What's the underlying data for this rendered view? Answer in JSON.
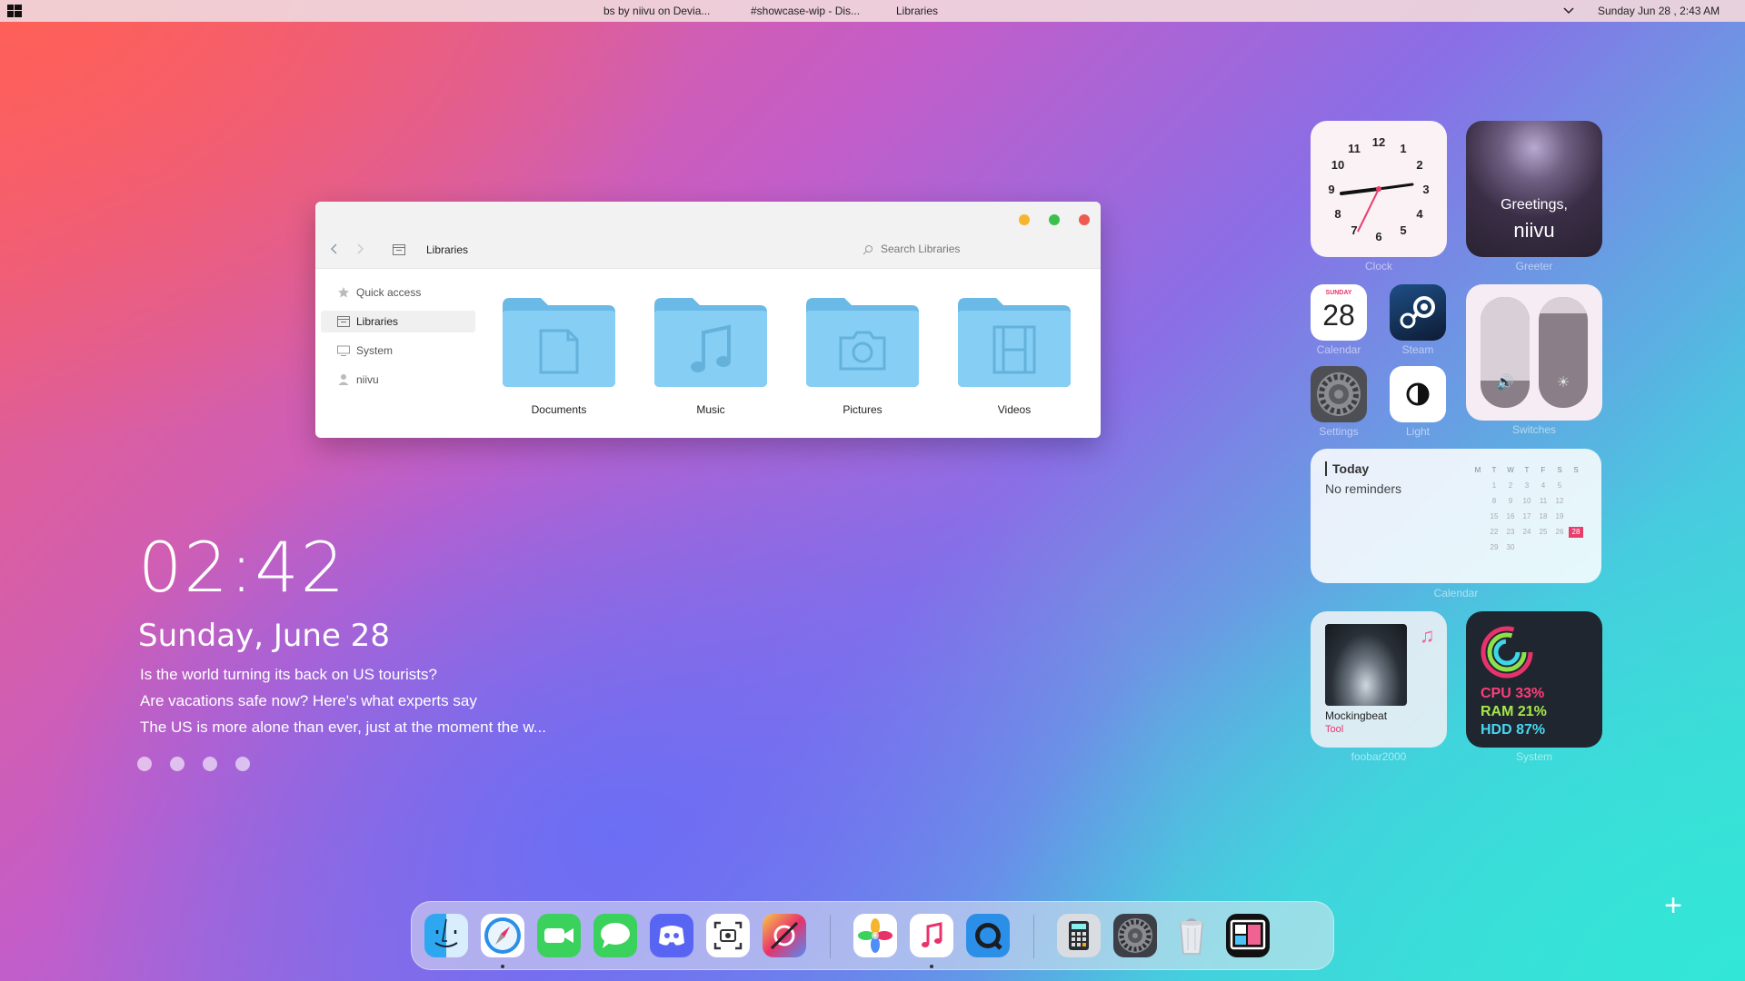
{
  "topbar": {
    "tasks": [
      "bs by niivu on Devia...",
      "#showcase-wip - Dis...",
      "Libraries"
    ],
    "datetime": "Sunday  Jun  28 ,   2:43 AM"
  },
  "explorer": {
    "breadcrumb": "Libraries",
    "search_placeholder": "Search Libraries",
    "sidebar": [
      {
        "label": "Quick access",
        "icon": "star-icon"
      },
      {
        "label": "Libraries",
        "icon": "library-icon"
      },
      {
        "label": "System",
        "icon": "monitor-icon"
      },
      {
        "label": "niivu",
        "icon": "user-icon"
      }
    ],
    "folders": [
      {
        "label": "Documents",
        "icon": "document-icon"
      },
      {
        "label": "Music",
        "icon": "music-note-icon"
      },
      {
        "label": "Pictures",
        "icon": "camera-icon"
      },
      {
        "label": "Videos",
        "icon": "film-icon"
      }
    ],
    "colors": {
      "close": "#ee5a4f",
      "maximize": "#3dbf4f",
      "minimize": "#f5b52f",
      "folder": "#7cc8f0"
    }
  },
  "desktop": {
    "time": "02:42",
    "date": "Sunday, June 28",
    "news": [
      "Is the world turning its back on US tourists?",
      "Are vacations safe now? Here's what experts say",
      "The US is more alone than ever, just at the moment the w..."
    ]
  },
  "widgets": {
    "clock": {
      "label": "Clock",
      "numbers": [
        "12",
        "1",
        "2",
        "3",
        "4",
        "5",
        "6",
        "7",
        "8",
        "9",
        "10",
        "11"
      ]
    },
    "greeter": {
      "label": "Greeter",
      "line1": "Greetings,",
      "line2": "niivu"
    },
    "calendar_tile": {
      "label": "Calendar",
      "weekday": "SUNDAY",
      "day": "28"
    },
    "steam": {
      "label": "Steam"
    },
    "settings": {
      "label": "Settings"
    },
    "light": {
      "label": "Light"
    },
    "switches": {
      "label": "Switches",
      "volume_level": 0.75,
      "brightness_level": 0.15
    },
    "reminders": {
      "title": "Today",
      "text": "No reminders",
      "label": "Calendar",
      "weekdays": [
        "M",
        "T",
        "W",
        "T",
        "F",
        "S",
        "S"
      ],
      "days": [
        [
          "",
          "1",
          "2",
          "3",
          "4",
          "5",
          ""
        ],
        [
          "",
          "8",
          "9",
          "10",
          "11",
          "12",
          ""
        ],
        [
          "",
          "15",
          "16",
          "17",
          "18",
          "19",
          ""
        ],
        [
          "",
          "22",
          "23",
          "24",
          "25",
          "26",
          "28"
        ],
        [
          "",
          "29",
          "30",
          "",
          "",
          "",
          ""
        ]
      ],
      "highlight": "28"
    },
    "music": {
      "label": "foobar2000",
      "song": "Mockingbeat",
      "artist": "Tool"
    },
    "system": {
      "label": "System",
      "cpu": "CPU 33%",
      "ram": "RAM 21%",
      "hdd": "HDD 87%"
    }
  },
  "dock": {
    "apps": [
      {
        "name": "finder-icon"
      },
      {
        "name": "safari-icon",
        "running": true
      },
      {
        "name": "facetime-icon"
      },
      {
        "name": "messages-icon"
      },
      {
        "name": "discord-icon"
      },
      {
        "name": "screenshot-icon"
      },
      {
        "name": "color-picker-icon"
      },
      {
        "name": "photos-icon"
      },
      {
        "name": "itunes-icon",
        "running": true
      },
      {
        "name": "quicktime-icon"
      },
      {
        "name": "calculator-icon"
      },
      {
        "name": "system-preferences-icon"
      },
      {
        "name": "trash-icon"
      },
      {
        "name": "desktop-widgets-icon"
      }
    ]
  }
}
